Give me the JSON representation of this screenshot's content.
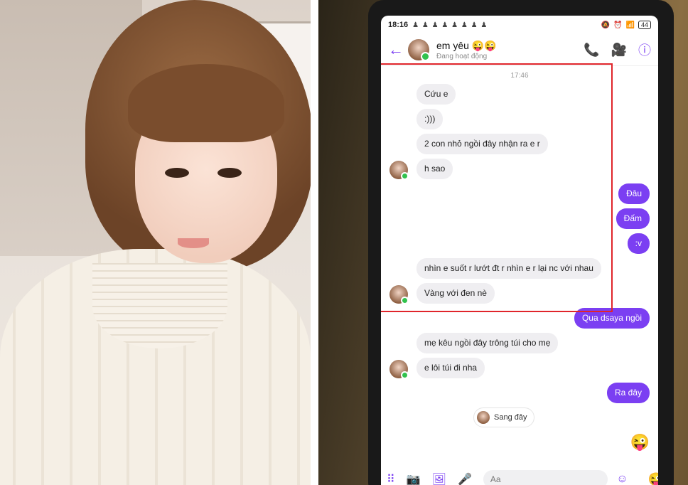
{
  "status_bar": {
    "time": "18:16",
    "notifications": "♟ ♟ ♟ ♟ ♟ ♟ ♟ ♟",
    "battery": "44"
  },
  "header": {
    "contact_name": "em yêu 😜😜",
    "contact_status": "Đang hoạt động"
  },
  "chat": {
    "timestamp": "17:46",
    "highlight_color": "#e0252b",
    "messages": [
      {
        "dir": "in",
        "text": "Cứu e",
        "avatar": false
      },
      {
        "dir": "in",
        "text": ":)))",
        "avatar": false
      },
      {
        "dir": "in",
        "text": "2 con nhỏ ngồi đây nhận ra e r",
        "avatar": false
      },
      {
        "dir": "in",
        "text": "h sao",
        "avatar": true
      },
      {
        "dir": "out",
        "text": "Đâu"
      },
      {
        "dir": "out",
        "text": "Đấm"
      },
      {
        "dir": "out",
        "text": ":v"
      },
      {
        "dir": "in",
        "text": "nhìn e suốt r lướt đt r nhìn e r lại nc với nhau",
        "avatar": false
      },
      {
        "dir": "in",
        "text": "Vàng với đen nè",
        "avatar": true
      },
      {
        "dir": "out",
        "text": "Qua dsaya ngồi"
      },
      {
        "dir": "in",
        "text": "mẹ kêu ngồi đây trông túi cho mẹ",
        "avatar": false
      },
      {
        "dir": "in",
        "text": "e lôi túi đi nha",
        "avatar": true
      },
      {
        "dir": "out",
        "text": "Ra đây"
      }
    ],
    "reaction_text": "Sang đây",
    "sticker": "😜"
  },
  "composer": {
    "placeholder": "Aa",
    "emoji": "😜"
  },
  "colors": {
    "accent": "#7b3ff2",
    "incoming_bubble": "#efeef1",
    "online": "#31c24d"
  }
}
